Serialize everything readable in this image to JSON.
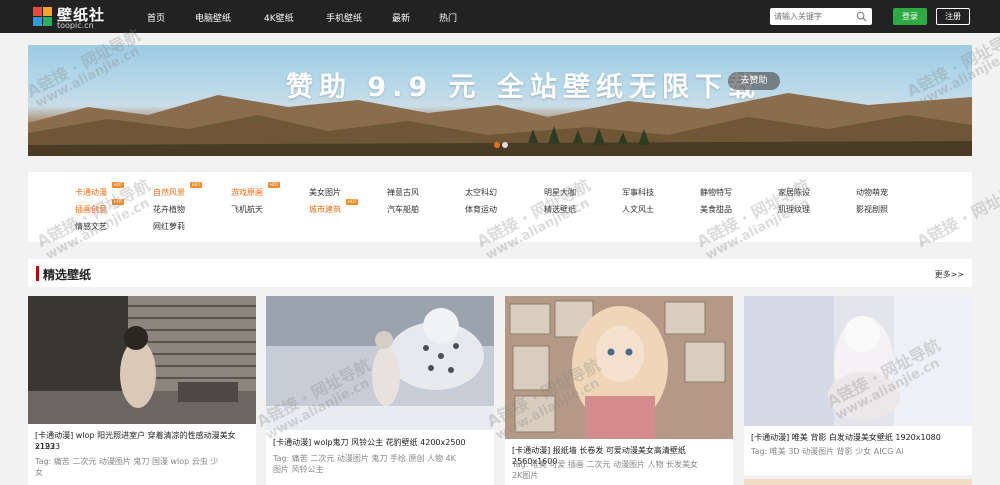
{
  "header": {
    "logo_title": "壁纸社",
    "logo_sub": "toopic.cn",
    "nav": [
      "首页",
      "电脑壁纸",
      "4K壁纸",
      "手机壁纸",
      "最新",
      "热门"
    ],
    "search_placeholder": "请输入关键字",
    "login_label": "登录",
    "register_label": "注册"
  },
  "banner": {
    "text": "赞助 9.9 元  全站壁纸无限下载",
    "button_label": "去赞助"
  },
  "categories": {
    "row1": [
      "卡通动漫",
      "自然风景",
      "游戏原画",
      "美女图片",
      "禅意古风",
      "太空科幻",
      "明星大咖",
      "军事科技",
      "静物特写",
      "家居陈设",
      "动物萌宠"
    ],
    "row2": [
      "插画创意",
      "花卉植物",
      "飞机航天",
      "城市建筑",
      "汽车船舶",
      "体育运动",
      "精选壁纸",
      "人文风土",
      "美食甜品",
      "肌理纹理",
      "影视剧照"
    ],
    "row3": [
      "情感文艺",
      "网红萝莉"
    ],
    "badge": "HOT"
  },
  "section": {
    "title": "精选壁纸",
    "more": "更多>>"
  },
  "cards": [
    {
      "caption_l1": "[卡通动漫] wlop 阳光照进室户 穿着清凉的性感动漫美女  2192",
      "caption_l2": "x1233",
      "tags_l1": "Tag:  痛苦   二次元   动漫图片   鬼刀   国漫   wlop   云虫   少",
      "tags_l2": "女"
    },
    {
      "caption_l1": "[卡通动漫] wolp鬼刀 风铃公主 花豹壁纸  4200x2500",
      "tags_l1": "Tag:  痛苦   二次元   动漫图片   鬼刀   手绘   原创   人物   4K",
      "tags_l2": "图片   风铃公主"
    },
    {
      "caption_l1": "[卡通动漫] 报纸墙 长卷发 可爱动漫美女高清壁纸   2560x1600",
      "tags_l1": "Tag:  唯美   可爱   插画   二次元   动漫图片   人物   长发美女",
      "tags_l2": "2K图片"
    },
    {
      "caption_l1": "[卡通动漫] 唯美 背影 白发动漫美女壁纸   1920x1080",
      "tags_l1": "Tag:  唯美   3D   动漫图片   背影   少女   AICG   Ai"
    }
  ],
  "watermark": {
    "line1": "A链接 · 网址导航",
    "line2": "www.alianjie.cn"
  }
}
